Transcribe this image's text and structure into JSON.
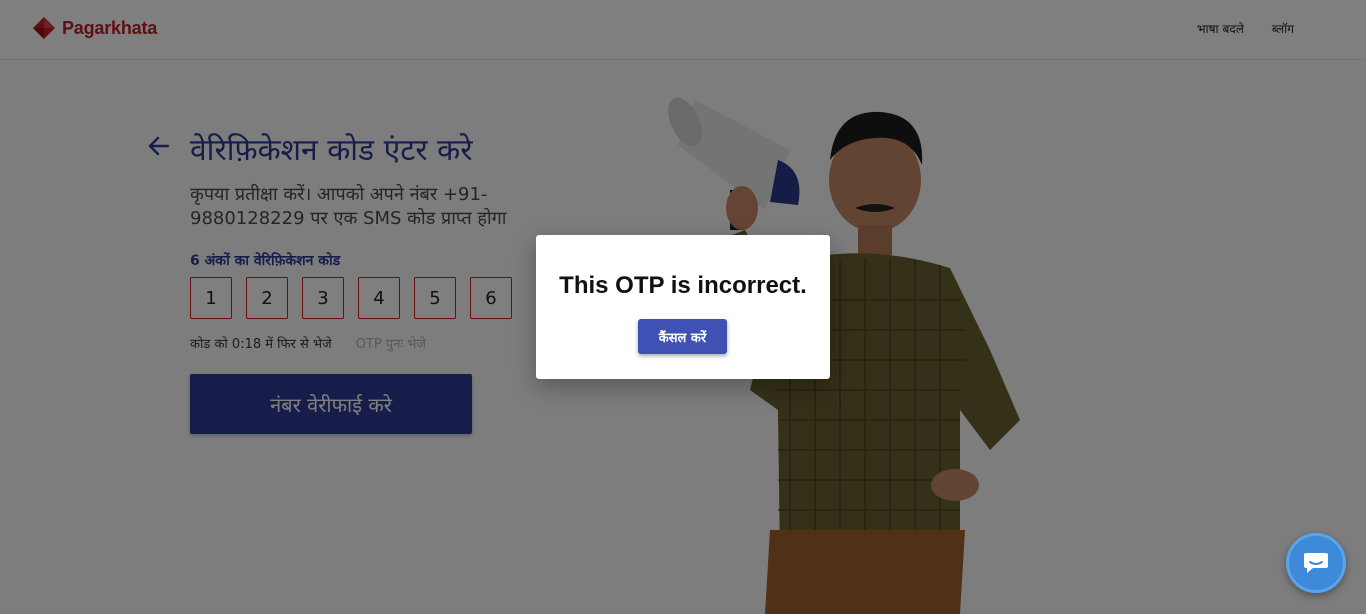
{
  "header": {
    "brand": "Pagarkhata",
    "nav": [
      "भाषा बदले",
      "ब्लॉग"
    ]
  },
  "main": {
    "title": "वेरिफ़िकेशन कोड एंटर करे",
    "subtitle": "कृपया प्रतीक्षा करें। आपको अपने नंबर +91-9880128229 पर एक SMS कोड प्राप्त होगा",
    "code_label": "6 अंकों का वेरिफ़िकेशन कोड",
    "otp_digits": [
      "1",
      "2",
      "3",
      "4",
      "5",
      "6"
    ],
    "resend_timer": "कोड को 0:18 में फिर से भेजे",
    "resend_link": "OTP पुनः भेजे",
    "verify_button": "नंबर वेरीफाई करे"
  },
  "dialog": {
    "message": "This OTP is incorrect.",
    "cancel_button": "कैंसल करें"
  },
  "colors": {
    "brand_red": "#c0202a",
    "primary_blue": "#2e3a95",
    "dialog_button": "#3f51b5",
    "otp_border": "#d11f25",
    "chat_blue": "#3d8ad9"
  },
  "icons": [
    "back-arrow-icon",
    "megaphone-icon",
    "chat-icon",
    "logo-icon"
  ]
}
